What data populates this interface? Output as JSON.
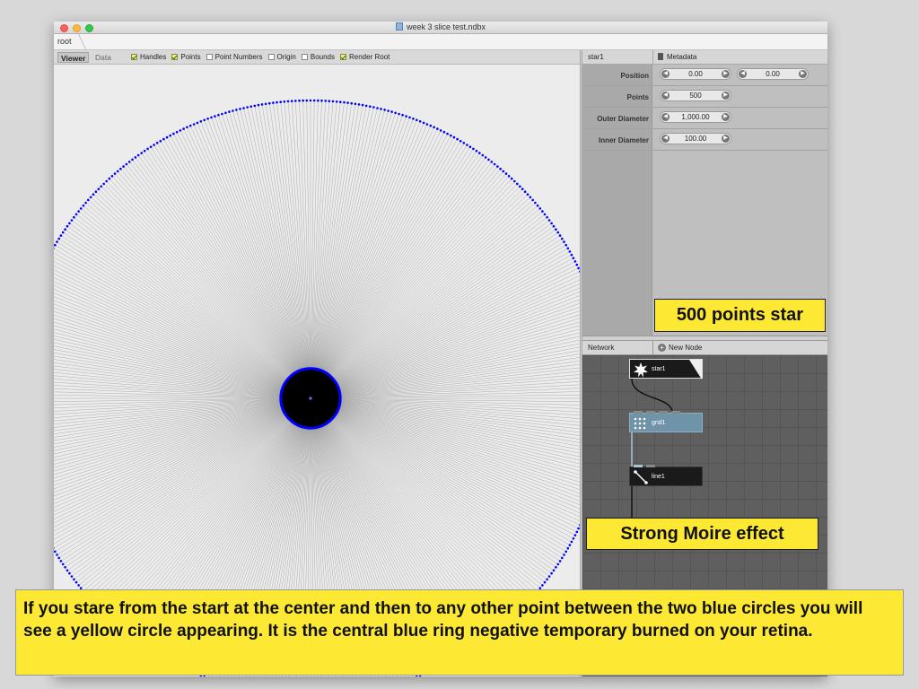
{
  "window": {
    "title": "week 3 slice test.ndbx",
    "breadcrumb": "root"
  },
  "viewer": {
    "tabs": [
      "Viewer",
      "Data"
    ],
    "options": [
      {
        "label": "Handles",
        "checked": true
      },
      {
        "label": "Points",
        "checked": true
      },
      {
        "label": "Point Numbers",
        "checked": false
      },
      {
        "label": "Origin",
        "checked": false
      },
      {
        "label": "Bounds",
        "checked": false
      },
      {
        "label": "Render Root",
        "checked": true
      }
    ]
  },
  "properties": {
    "node_name": "star1",
    "metadata_label": "Metadata",
    "rows": [
      {
        "label": "Position",
        "values": [
          "0.00",
          "0.00"
        ]
      },
      {
        "label": "Points",
        "values": [
          "500"
        ]
      },
      {
        "label": "Outer Diameter",
        "values": [
          "1,000.00"
        ]
      },
      {
        "label": "Inner Diameter",
        "values": [
          "100.00"
        ]
      }
    ]
  },
  "network": {
    "label": "Network",
    "new_node_label": "New Node",
    "nodes": [
      {
        "name": "star1",
        "icon": "star-icon"
      },
      {
        "name": "grid1",
        "icon": "grid-icon"
      },
      {
        "name": "line1",
        "icon": "line-icon"
      }
    ]
  },
  "annotations": {
    "star_callout": "500 points star",
    "moire_callout": "Strong Moire effect",
    "bottom_note": "If you stare from the start at the center and then to any other point between the two blue circles you will see a yellow circle appearing. It is the central blue ring negative temporary burned on your retina."
  },
  "colors": {
    "callout_bg": "#fde933",
    "ring_color": "#0000ff",
    "grid_node": "#6f93a8"
  }
}
